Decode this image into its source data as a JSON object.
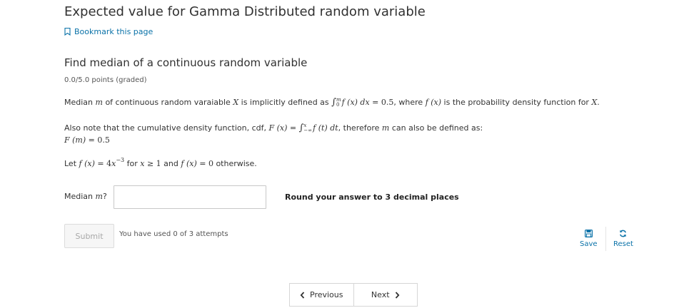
{
  "page": {
    "title": "Expected value for Gamma Distributed random variable"
  },
  "bookmark": {
    "label": "Bookmark this page",
    "icon": "bookmark-icon",
    "color": "#0a72a8"
  },
  "problem": {
    "title": "Find median of a continuous random variable",
    "points": "0.0/5.0 points (graded)",
    "p1": {
      "a": "Median ",
      "m": "m",
      "b": " of continuous random varaiable ",
      "X": "X",
      "c": " is implicitly defined as ",
      "int_upper": "m",
      "int_lower": "0",
      "integrand": "f (x) dx",
      "eq": " = 0.5",
      "d": ", where ",
      "f": "f (x)",
      "e": " is the probability density function for ",
      "X2": "X",
      "end": "."
    },
    "p2": {
      "a": "Also note that the cumulative density function, cdf, ",
      "F": "F (x)",
      "eq": " = ",
      "int_upper": "x",
      "int_lower": "−∞",
      "integrand": "f (t) dt",
      "b": ", therefore ",
      "m": "m",
      "c": " can also be defined as:"
    },
    "p3": {
      "F": "F (m)",
      "eq": " = 0.5"
    },
    "p4": {
      "a": "Let ",
      "f": "f (x)",
      "eq": " = 4",
      "x": "x",
      "exp": "−3",
      "b": " for ",
      "x2": "x",
      "ge": " ≥ 1",
      "c": " and ",
      "f2": "f (x)",
      "eq2": " = 0",
      "d": " otherwise."
    },
    "answer": {
      "label_prefix": "Median ",
      "label_var": "m",
      "label_suffix": "?",
      "value": "",
      "placeholder": ""
    },
    "hint": "Round your answer to 3 decimal places"
  },
  "actions": {
    "submit_label": "Submit",
    "attempts_text": "You have used 0 of 3 attempts",
    "save_label": "Save",
    "reset_label": "Reset",
    "link_color": "#0a72a8"
  },
  "nav": {
    "previous_label": "Previous",
    "next_label": "Next"
  }
}
